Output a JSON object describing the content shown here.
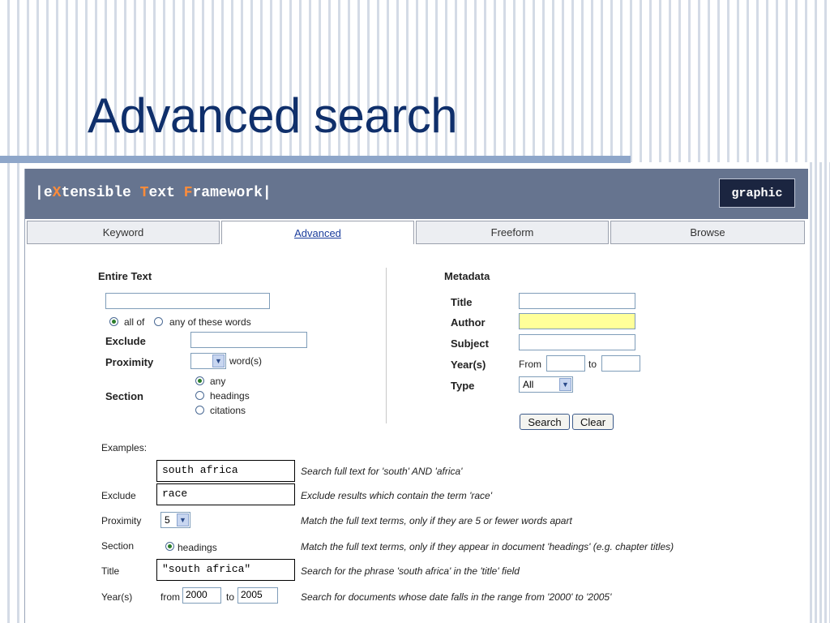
{
  "slide": {
    "title": "Advanced search"
  },
  "app": {
    "logo": {
      "pipe_l": "|",
      "e": "e",
      "x": "X",
      "tensible": "tensible ",
      "t": "T",
      "ext": "ext ",
      "f": "F",
      "ramework": "ramework",
      "pipe_r": "|"
    },
    "graphic_label": "graphic",
    "tabs": [
      {
        "label": "Keyword"
      },
      {
        "label": "Advanced"
      },
      {
        "label": "Freeform"
      },
      {
        "label": "Browse"
      }
    ]
  },
  "entire_text": {
    "heading": "Entire Text",
    "all_of": "all of",
    "any_of": "any of these words",
    "exclude": "Exclude",
    "proximity": "Proximity",
    "words": "word(s)",
    "section": "Section",
    "section_options": [
      "any",
      "headings",
      "citations"
    ]
  },
  "metadata": {
    "heading": "Metadata",
    "title": "Title",
    "author": "Author",
    "subject": "Subject",
    "years": "Year(s)",
    "from": "From",
    "to": "to",
    "type": "Type",
    "type_value": "All",
    "search_btn": "Search",
    "clear_btn": "Clear"
  },
  "examples": {
    "heading": "Examples:",
    "rows": [
      {
        "label": "",
        "value": "south africa",
        "desc": "Search full text for 'south' AND 'africa'"
      },
      {
        "label": "Exclude",
        "value": "race",
        "desc": "Exclude results which contain the term 'race'"
      },
      {
        "label": "Proximity",
        "value": "5",
        "desc": "Match the full text terms, only if they are 5 or fewer words apart"
      },
      {
        "label": "Section",
        "value": "headings",
        "desc": "Match the full text terms, only if they appear in document 'headings' (e.g. chapter titles)"
      },
      {
        "label": "Title",
        "value": "\"south africa\"",
        "desc": "Search for the phrase 'south africa' in the 'title' field"
      },
      {
        "label": "Year(s)",
        "from": "from",
        "from_value": "2000",
        "to": "to",
        "to_value": "2005",
        "desc": "Search for documents whose date falls in the range from '2000' to '2005'"
      }
    ]
  }
}
